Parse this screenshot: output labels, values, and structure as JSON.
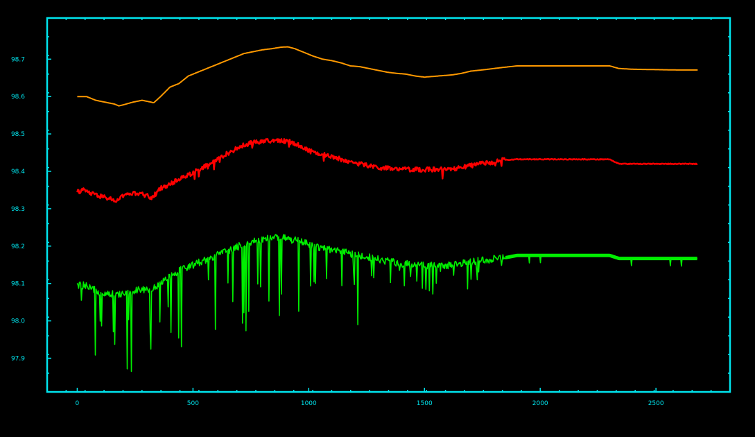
{
  "chart_data": {
    "type": "line",
    "title": "",
    "xlabel": "",
    "ylabel": "",
    "xlim": [
      -130,
      2820
    ],
    "ylim": [
      97.81,
      98.81
    ],
    "x_ticks": [
      0,
      500,
      1000,
      1500,
      2000,
      2500
    ],
    "y_ticks": [
      97.9,
      98.0,
      98.1,
      98.2,
      98.3,
      98.4,
      98.5,
      98.6,
      98.7
    ],
    "x_tick_labels": [
      "0",
      "500",
      "1000",
      "1500",
      "2000",
      "2500"
    ],
    "y_tick_labels": [
      "97.9",
      "98.0",
      "98.1",
      "98.2",
      "98.3",
      "98.4",
      "98.5",
      "98.6",
      "98.7"
    ],
    "grid": false,
    "legend": "none",
    "series": [
      {
        "color": "#ff9900",
        "style": "smooth",
        "x": [
          0,
          40,
          80,
          120,
          160,
          180,
          200,
          240,
          280,
          320,
          330,
          360,
          400,
          440,
          480,
          520,
          560,
          600,
          640,
          680,
          720,
          760,
          800,
          840,
          880,
          910,
          940,
          980,
          1020,
          1060,
          1100,
          1140,
          1180,
          1220,
          1260,
          1300,
          1340,
          1380,
          1420,
          1460,
          1500,
          1560,
          1620,
          1660,
          1700,
          1760,
          1800,
          1840,
          1900,
          2000,
          2100,
          2200,
          2300,
          2340,
          2400,
          2500,
          2600,
          2680
        ],
        "y": [
          98.6,
          98.6,
          98.59,
          98.585,
          98.58,
          98.575,
          98.578,
          98.585,
          98.59,
          98.585,
          98.583,
          98.6,
          98.625,
          98.635,
          98.655,
          98.665,
          98.675,
          98.685,
          98.695,
          98.705,
          98.715,
          98.72,
          98.725,
          98.728,
          98.732,
          98.733,
          98.728,
          98.718,
          98.708,
          98.7,
          98.696,
          98.69,
          98.682,
          98.68,
          98.675,
          98.67,
          98.665,
          98.662,
          98.66,
          98.655,
          98.652,
          98.655,
          98.658,
          98.662,
          98.668,
          98.672,
          98.675,
          98.678,
          98.682,
          98.682,
          98.682,
          98.682,
          98.682,
          98.675,
          98.673,
          98.672,
          98.671,
          98.671
        ]
      },
      {
        "color": "#ff0000",
        "style": "noisy",
        "x": [
          0,
          30,
          60,
          90,
          120,
          150,
          170,
          190,
          210,
          240,
          270,
          300,
          320,
          340,
          360,
          400,
          440,
          480,
          520,
          560,
          600,
          640,
          680,
          720,
          760,
          800,
          840,
          880,
          910,
          940,
          980,
          1020,
          1060,
          1100,
          1140,
          1180,
          1220,
          1260,
          1300,
          1340,
          1380,
          1420,
          1460,
          1500,
          1540,
          1580,
          1620,
          1660,
          1700,
          1740,
          1800,
          1840,
          1900,
          2000,
          2100,
          2200,
          2300,
          2340,
          2400,
          2500,
          2600,
          2680
        ],
        "y": [
          98.345,
          98.35,
          98.34,
          98.335,
          98.33,
          98.325,
          98.32,
          98.33,
          98.34,
          98.34,
          98.34,
          98.335,
          98.33,
          98.34,
          98.355,
          98.365,
          98.38,
          98.39,
          98.405,
          98.415,
          98.43,
          98.445,
          98.458,
          98.47,
          98.478,
          98.48,
          98.482,
          98.482,
          98.48,
          98.475,
          98.462,
          98.452,
          98.445,
          98.44,
          98.432,
          98.425,
          98.42,
          98.415,
          98.41,
          98.408,
          98.405,
          98.405,
          98.405,
          98.405,
          98.405,
          98.405,
          98.405,
          98.41,
          98.415,
          98.42,
          98.425,
          98.43,
          98.432,
          98.432,
          98.432,
          98.432,
          98.432,
          98.42,
          98.42,
          98.42,
          98.42,
          98.42
        ]
      },
      {
        "color": "#00ee00",
        "style": "spiky",
        "x": [
          0,
          30,
          60,
          90,
          120,
          150,
          180,
          210,
          240,
          270,
          300,
          320,
          340,
          360,
          400,
          440,
          480,
          520,
          560,
          600,
          640,
          680,
          720,
          760,
          800,
          840,
          880,
          910,
          940,
          980,
          1020,
          1060,
          1100,
          1140,
          1180,
          1220,
          1260,
          1300,
          1340,
          1380,
          1420,
          1460,
          1500,
          1540,
          1580,
          1620,
          1660,
          1700,
          1740,
          1790,
          1840,
          1900,
          2000,
          2100,
          2200,
          2300,
          2340,
          2400,
          2500,
          2600,
          2680
        ],
        "y": [
          98.095,
          98.095,
          98.085,
          98.08,
          98.075,
          98.072,
          98.07,
          98.075,
          98.08,
          98.085,
          98.085,
          98.085,
          98.09,
          98.105,
          98.12,
          98.135,
          98.145,
          98.155,
          98.165,
          98.175,
          98.185,
          98.195,
          98.205,
          98.212,
          98.218,
          98.222,
          98.222,
          98.22,
          98.215,
          98.21,
          98.2,
          98.195,
          98.19,
          98.185,
          98.18,
          98.175,
          98.17,
          98.165,
          98.16,
          98.155,
          98.152,
          98.15,
          98.148,
          98.148,
          98.148,
          98.148,
          98.152,
          98.158,
          98.162,
          98.165,
          98.168,
          98.175,
          98.175,
          98.175,
          98.175,
          98.175,
          98.167,
          98.167,
          98.167,
          98.167,
          98.167
        ]
      }
    ]
  },
  "colors": {
    "background": "#000000",
    "frame": "#00e5ee",
    "tick_label": "#00e5ee"
  }
}
